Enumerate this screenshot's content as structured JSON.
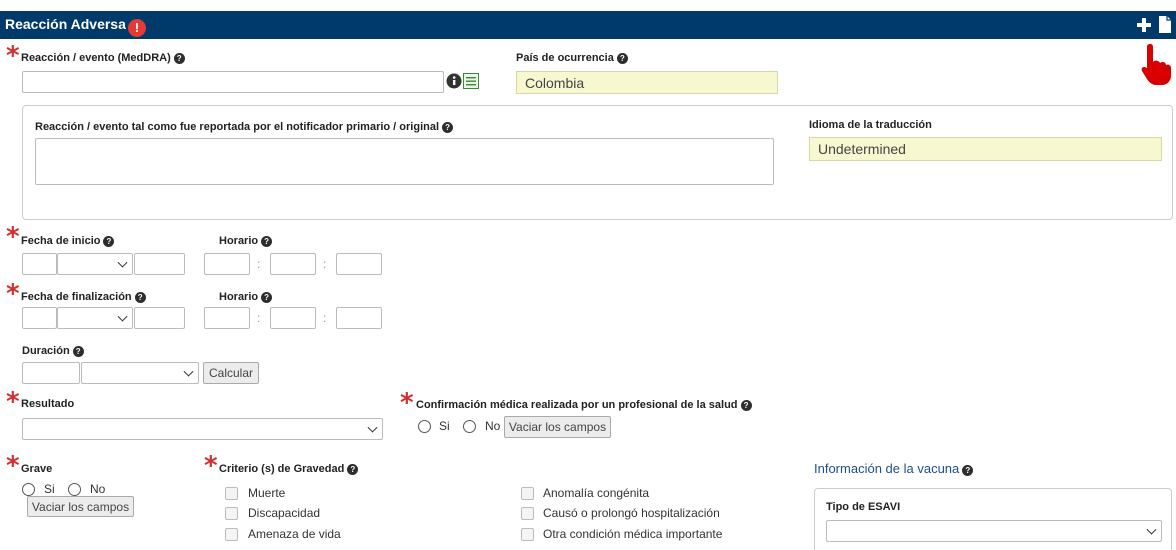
{
  "header": {
    "title": "Reacción Adversa",
    "alert_glyph": "!"
  },
  "required_mark": "*",
  "help_glyph": "?",
  "reaction": {
    "label": "Reacción / evento (MedDRA)",
    "value": ""
  },
  "country": {
    "label": "País de ocurrencia",
    "value": "Colombia"
  },
  "original": {
    "label": "Reacción / evento tal como fue reportada por el notificador primario / original",
    "value": ""
  },
  "translation": {
    "label": "Idioma de la traducción",
    "value": "Undetermined"
  },
  "start": {
    "label": "Fecha de inicio",
    "time_label": "Horario"
  },
  "end": {
    "label": "Fecha de finalización",
    "time_label": "Horario"
  },
  "time_sep": ":",
  "duration": {
    "label": "Duración",
    "calc_label": "Calcular"
  },
  "result": {
    "label": "Resultado",
    "value": ""
  },
  "confirm": {
    "label": "Confirmación médica realizada por un profesional de la salud",
    "yes": "Si",
    "no": "No",
    "clear": "Vaciar los campos"
  },
  "grave": {
    "label": "Grave",
    "yes": "Si",
    "no": "No",
    "clear": "Vaciar los campos"
  },
  "criteria": {
    "label": "Criterio (s) de Gravedad",
    "col1": [
      "Muerte",
      "Discapacidad",
      "Amenaza de vida"
    ],
    "col2": [
      "Anomalía congénita",
      "Causó o prolongó hospitalización",
      "Otra condición médica importante"
    ]
  },
  "vaccine": {
    "title": "Información de la vacuna",
    "esavi_label": "Tipo de ESAVI",
    "esavi_value": ""
  },
  "colors": {
    "header": "#003a6b",
    "required": "#d32f2f",
    "alert": "#e53935",
    "readonly_bg": "#f8f8d0",
    "vaccine_title": "#1d4f8a"
  },
  "icons": [
    "add-icon",
    "document-icon",
    "pointer-hand-icon",
    "info-icon",
    "list-icon",
    "help-icon",
    "chevron-down-icon"
  ]
}
